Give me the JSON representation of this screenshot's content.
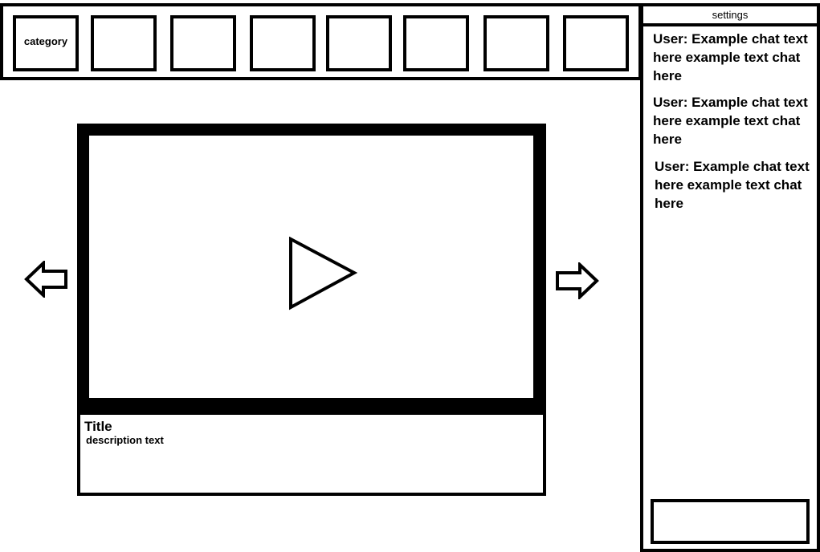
{
  "categories": {
    "first_label": "category"
  },
  "sidebar": {
    "settings_label": "settings",
    "messages": [
      "User: Example chat text here example text chat here",
      "User: Example chat text here example text chat here",
      "User: Example chat text here example text chat here"
    ]
  },
  "video": {
    "title": "Title",
    "description": "description text"
  },
  "icons": {
    "play": "play-icon",
    "prev": "arrow-left-icon",
    "next": "arrow-right-icon"
  }
}
